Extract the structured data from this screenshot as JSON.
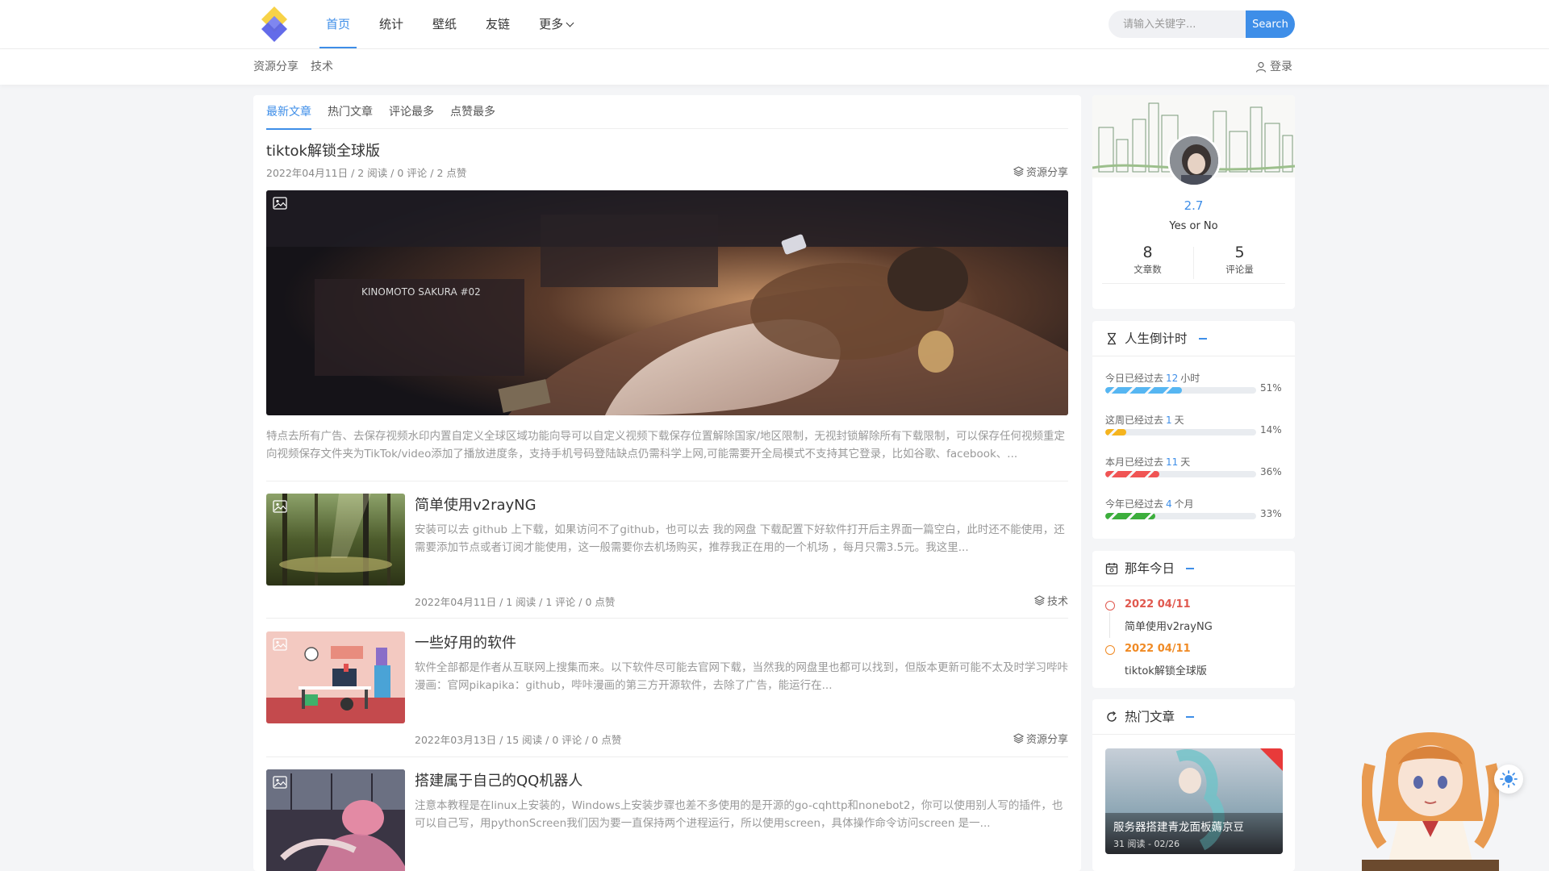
{
  "nav": {
    "items": [
      {
        "label": "首页",
        "active": true
      },
      {
        "label": "统计",
        "active": false
      },
      {
        "label": "壁纸",
        "active": false
      },
      {
        "label": "友链",
        "active": false
      },
      {
        "label": "更多",
        "active": false
      }
    ],
    "search_placeholder": "请输入关键字...",
    "search_button": "Search"
  },
  "subnav": {
    "items": [
      "资源分享",
      "技术"
    ],
    "login": "登录"
  },
  "tabs": [
    "最新文章",
    "热门文章",
    "评论最多",
    "点赞最多"
  ],
  "posts": [
    {
      "title": "tiktok解锁全球版",
      "meta": "2022年04月11日 / 2 阅读 / 0 评论 / 2 点赞",
      "category": "资源分享",
      "image_caption": "KINOMOTO SAKURA #02",
      "excerpt": "特点去所有广告、去保存视频水印内置自定义全球区域功能向导可以自定义视频下载保存位置解除国家/地区限制，无视封锁解除所有下载限制，可以保存任何视频重定向视频保存文件夹为TikTok/video添加了播放进度条，支持手机号码登陆缺点仍需科学上网,可能需要开全局模式不支持其它登录，比如谷歌、facebook、..."
    },
    {
      "title": "简单使用v2rayNG",
      "meta": "2022年04月11日 / 1 阅读 / 1 评论 / 0 点赞",
      "category": "技术",
      "excerpt": "安装可以去 github 上下载，如果访问不了github，也可以去 我的网盘 下载配置下好软件打开后主界面一篇空白，此时还不能使用，还需要添加节点或者订阅才能使用，这一般需要你去机场购买，推荐我正在用的一个机场 ，每月只需3.5元。我这里..."
    },
    {
      "title": "一些好用的软件",
      "meta": "2022年03月13日 / 15 阅读 / 0 评论 / 0 点赞",
      "category": "资源分享",
      "excerpt": "软件全部都是作者从互联网上搜集而来。以下软件尽可能去官网下载，当然我的网盘里也都可以找到，但版本更新可能不太及时学习哔咔漫画：官网pikapika：github，哔咔漫画的第三方开源软件，去除了广告，能运行在..."
    },
    {
      "title": "搭建属于自己的QQ机器人",
      "meta": "",
      "category": "",
      "excerpt": "注意本教程是在linux上安装的，Windows上安装步骤也差不多使用的是开源的go-cqhttp和nonebot2，你可以使用别人写的插件，也可以自己写，用pythonScreen我们因为要一直保持两个进程运行，所以使用screen，具体操作命令访问screen 是一..."
    }
  ],
  "profile": {
    "version": "2.7",
    "motto": "Yes or No",
    "stats": [
      {
        "value": "8",
        "label": "文章数"
      },
      {
        "value": "5",
        "label": "评论量"
      }
    ]
  },
  "countdown": {
    "title": "人生倒计时",
    "rows": [
      {
        "prefix": "今日已经过去",
        "num": "12",
        "unit": "小时",
        "percent": "51%",
        "fraction": 0.51,
        "color": "#56b6f2"
      },
      {
        "prefix": "这周已经过去",
        "num": "1",
        "unit": "天",
        "percent": "14%",
        "fraction": 0.14,
        "color": "#f5b41e"
      },
      {
        "prefix": "本月已经过去",
        "num": "11",
        "unit": "天",
        "percent": "36%",
        "fraction": 0.36,
        "color": "#f05454"
      },
      {
        "prefix": "今年已经过去",
        "num": "4",
        "unit": "个月",
        "percent": "33%",
        "fraction": 0.33,
        "color": "#3cae3c"
      }
    ]
  },
  "today": {
    "title": "那年今日",
    "items": [
      {
        "date": "2022 04/11",
        "text": "简单使用v2rayNG",
        "color": "#e0584e"
      },
      {
        "date": "2022 04/11",
        "text": "tiktok解锁全球版",
        "color": "#f08a24"
      }
    ]
  },
  "hot": {
    "title": "热门文章",
    "post_title": "服务器搭建青龙面板薅京豆",
    "post_meta": "31 阅读 - 02/26"
  },
  "colors": {
    "accent": "#3e8ee8"
  }
}
